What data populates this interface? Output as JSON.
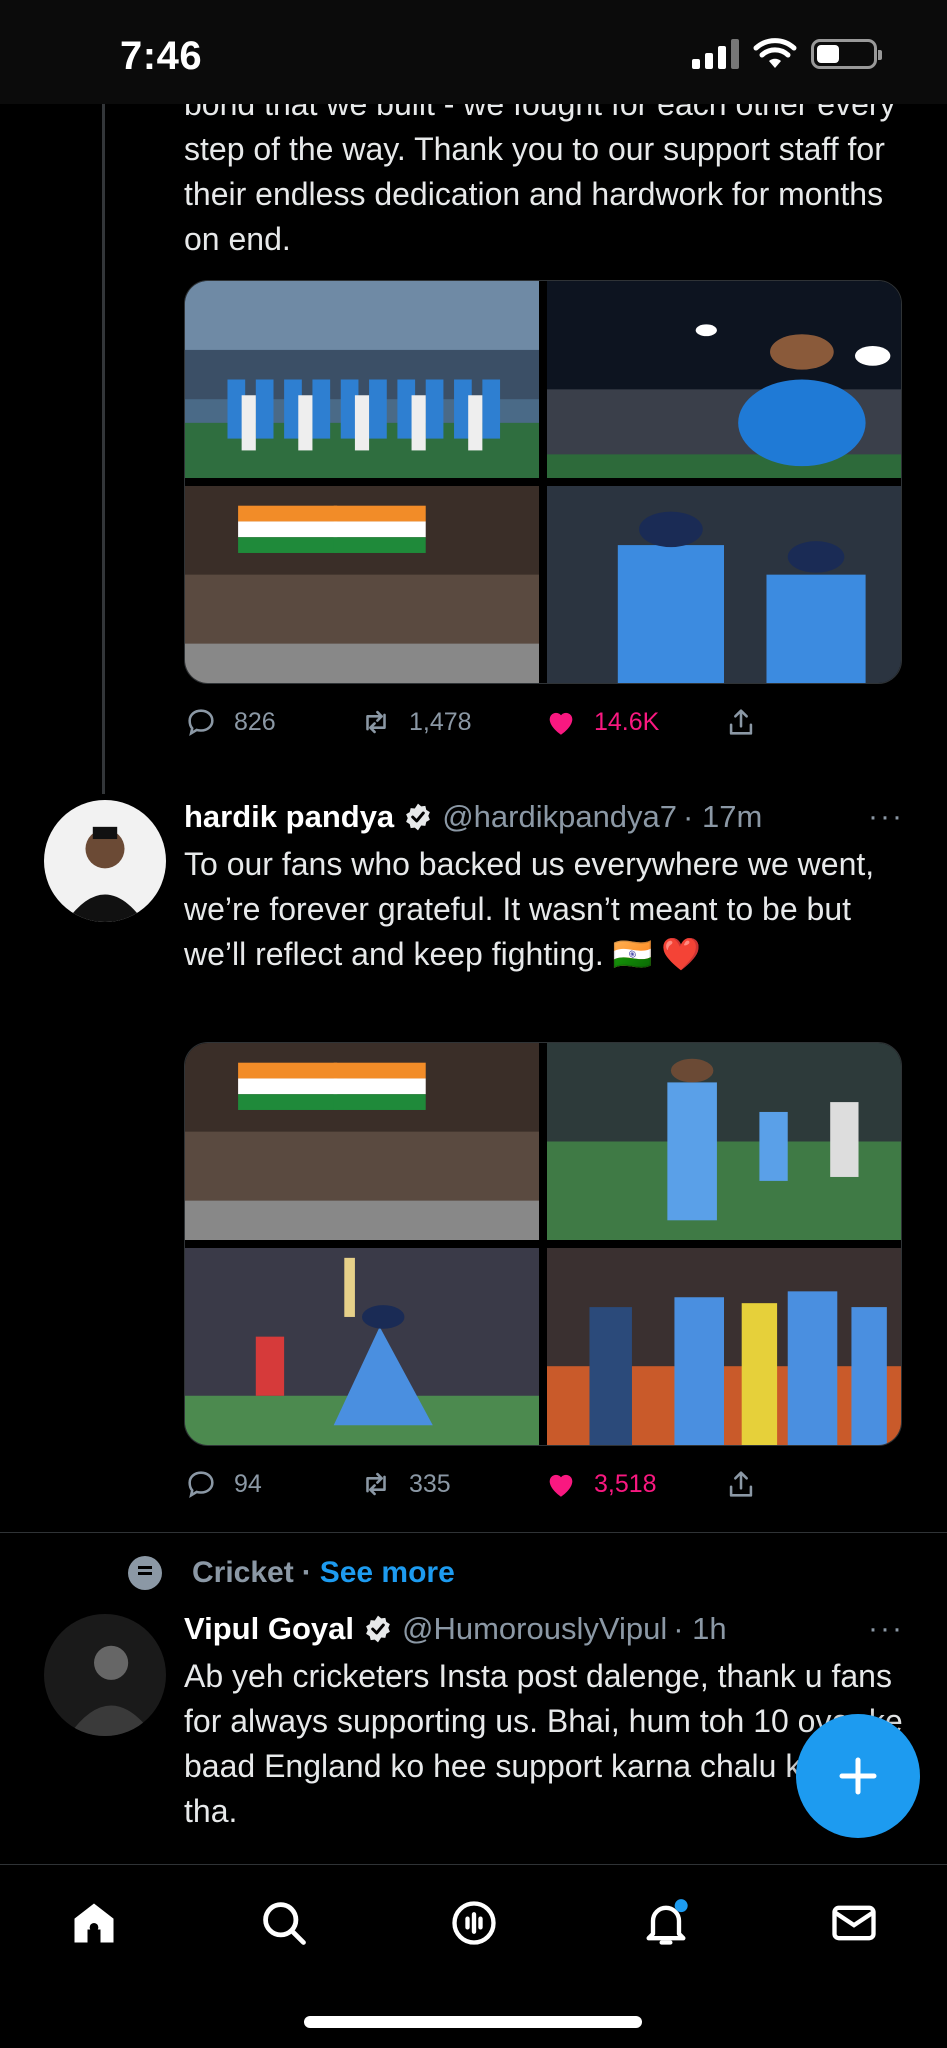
{
  "status_bar": {
    "time": "7:46"
  },
  "colors": {
    "accent": "#1d9bf0",
    "like": "#f91880",
    "muted": "#8b98a5",
    "background": "#000000"
  },
  "tweets": [
    {
      "text_partial": "bond that we built - we fought for each other every step of the way. Thank you to our support staff for their endless dedication and hardwork for months on end.",
      "actions": {
        "replies": "826",
        "retweets": "1,478",
        "likes": "14.6K"
      }
    },
    {
      "display_name": "hardik pandya",
      "handle": "@hardikpandya7",
      "time": "· 17m",
      "text": "To our fans who backed us everywhere we went, we’re forever grateful. It wasn’t meant to be but we’ll reflect and keep fighting. 🇮🇳 ❤️",
      "actions": {
        "replies": "94",
        "retweets": "335",
        "likes": "3,518"
      }
    },
    {
      "topic": "Cricket",
      "topic_separator": "·",
      "see_more": "See more",
      "display_name": "Vipul Goyal",
      "handle": "@HumorouslyVipul",
      "time": "· 1h",
      "text": "Ab yeh cricketers Insta post dalenge, thank u fans for always supporting us. Bhai, hum toh 10 over ke baad England ko hee support karna chalu kar diya tha."
    }
  ],
  "more_label": "···",
  "nav": [
    "home-icon",
    "search-icon",
    "spaces-icon",
    "notifications-icon",
    "messages-icon"
  ]
}
